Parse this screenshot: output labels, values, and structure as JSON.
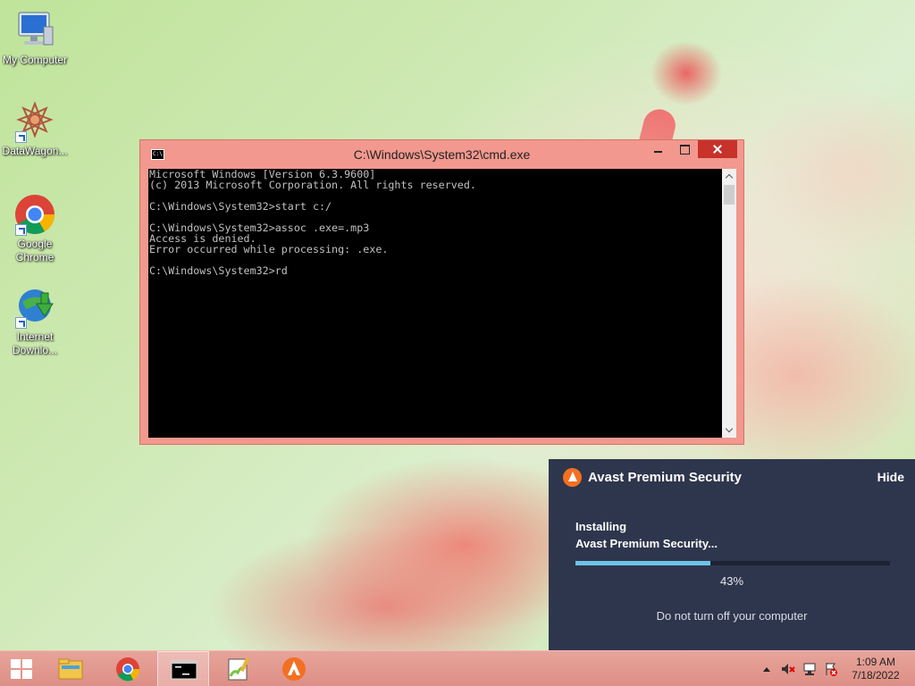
{
  "desktop": {
    "icons": [
      {
        "label": "My Computer",
        "icon": "computer-icon"
      },
      {
        "label": "DataWagon...",
        "icon": "datawagon-icon"
      },
      {
        "label": "Google Chrome",
        "icon": "chrome-icon"
      },
      {
        "label": "Internet Downlo...",
        "icon": "internet-download-manager-icon"
      }
    ]
  },
  "cmd": {
    "title": "C:\\Windows\\System32\\cmd.exe",
    "lines": [
      "Microsoft Windows [Version 6.3.9600]",
      "(c) 2013 Microsoft Corporation. All rights reserved.",
      "",
      "C:\\Windows\\System32>start c:/",
      "",
      "C:\\Windows\\System32>assoc .exe=.mp3",
      "Access is denied.",
      "Error occurred while processing: .exe.",
      "",
      "C:\\Windows\\System32>rd"
    ],
    "title_bar_color": "#f2988e",
    "close_color": "#c7322b"
  },
  "avast": {
    "title": "Avast Premium Security",
    "hide_label": "Hide",
    "status_line1": "Installing",
    "status_line2": "Avast Premium Security...",
    "progress_percent": 43,
    "progress_label": "43%",
    "note": "Do not turn off your computer",
    "panel_color": "#2e364d",
    "accent_color": "#f37022",
    "progress_color": "#6fc3e8"
  },
  "taskbar": {
    "items": [
      {
        "name": "file-explorer",
        "icon": "folder-icon",
        "active": false
      },
      {
        "name": "google-chrome",
        "icon": "chrome-icon",
        "active": false
      },
      {
        "name": "command-prompt",
        "icon": "cmd-icon",
        "active": true
      },
      {
        "name": "notepad-plus-plus",
        "icon": "notepad-plus-plus-icon",
        "active": false
      },
      {
        "name": "avast",
        "icon": "avast-icon",
        "active": false
      }
    ],
    "tray_icons": [
      "speaker-muted-icon",
      "network-icon",
      "action-center-flag-icon"
    ],
    "clock": {
      "time": "1:09 AM",
      "date": "7/18/2022"
    },
    "color": "#e3998f"
  }
}
